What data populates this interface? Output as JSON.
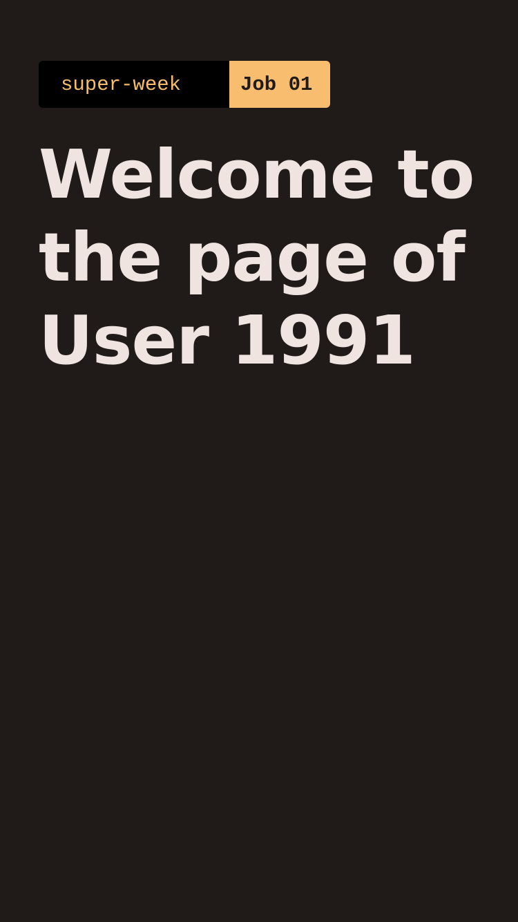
{
  "badge": {
    "tag": "super-week",
    "job": "Job 01"
  },
  "headline": {
    "lines": [
      "Welcome to",
      "the page of",
      "User 1991"
    ]
  },
  "colors": {
    "background": "#201b18",
    "accent": "#f8bd6e",
    "text": "#efe4e0",
    "badge_dark": "#000000"
  }
}
